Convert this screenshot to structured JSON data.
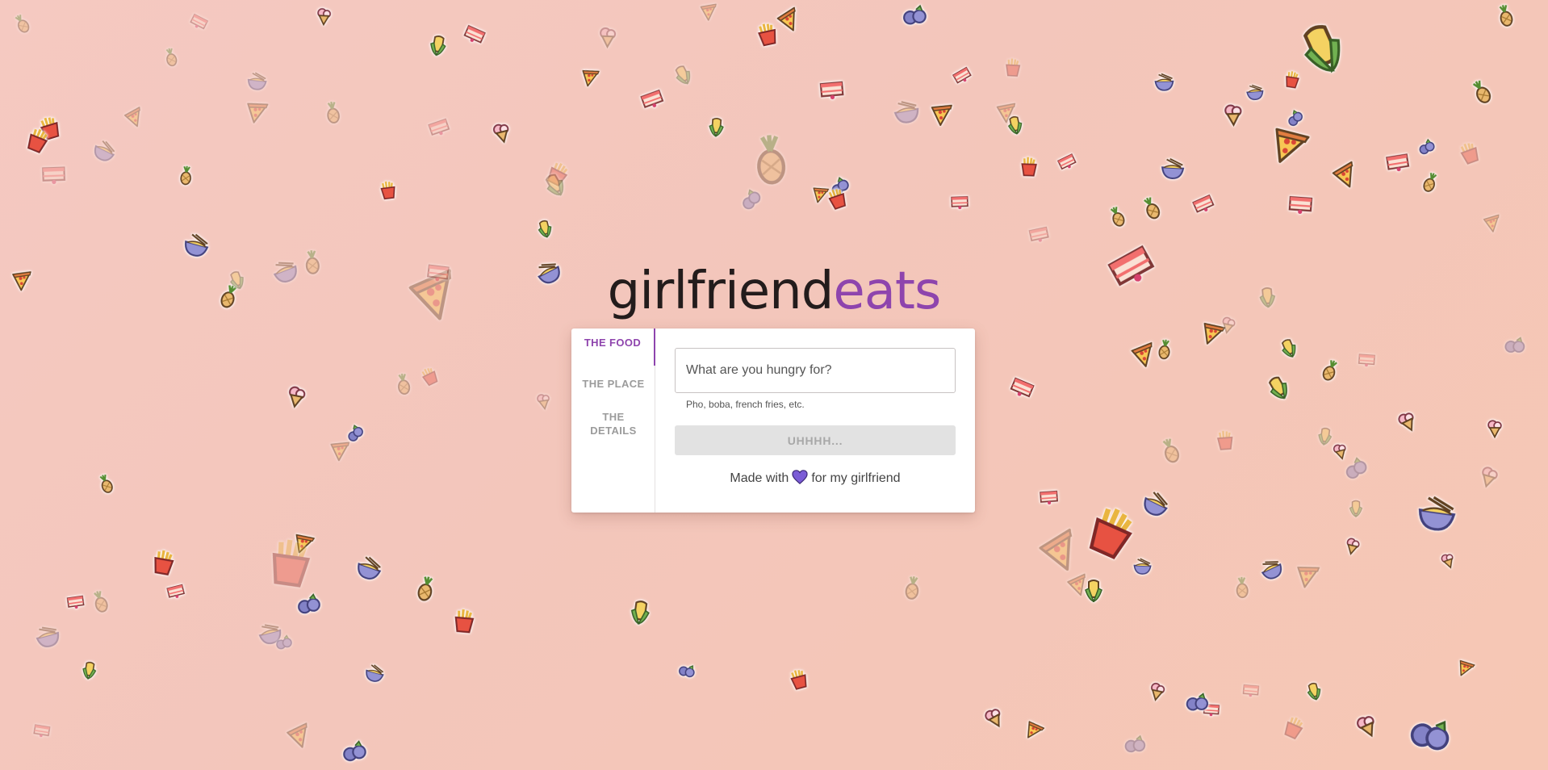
{
  "logo": {
    "main": "girlfriend",
    "accent": "eats"
  },
  "tabs": [
    {
      "label": "THE FOOD",
      "active": true
    },
    {
      "label": "THE PLACE",
      "active": false
    },
    {
      "label": "THE DETAILS",
      "active": false
    }
  ],
  "search": {
    "placeholder": "What are you hungry for?",
    "value": "",
    "hint": "Pho, boba, french fries, etc."
  },
  "submit": {
    "label": "UHHHH..."
  },
  "footer": {
    "before": "Made with",
    "after": "for my girlfriend",
    "icon": "heart-icon"
  },
  "colors": {
    "accent": "#8e44ad",
    "heart": "#7b5cd6",
    "background": "#f4c7bc"
  },
  "background_icons": [
    "pizza-icon",
    "corn-icon",
    "blueberry-icon",
    "cake-icon",
    "ramen-icon",
    "fries-icon",
    "ice-cream-icon",
    "pineapple-icon"
  ]
}
